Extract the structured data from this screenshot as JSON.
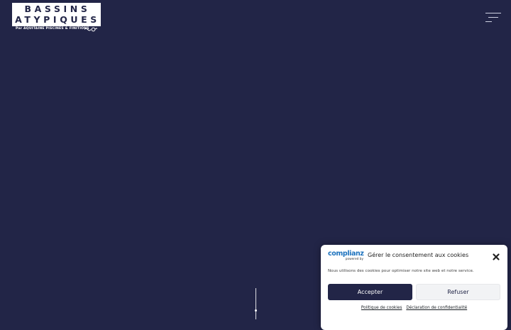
{
  "logo": {
    "line1": "BASSINS",
    "line2": "ATYPIQUES",
    "tagline": "Par AQUITAINE PISCINES & FINITIONS"
  },
  "menu": {
    "icon": "hamburger-menu-icon"
  },
  "scroll": {
    "icon": "scroll-down-indicator"
  },
  "cookies": {
    "brand": "complianz",
    "powered_by": "powered by",
    "title": "Gérer le consentement aux cookies",
    "close_icon": "close-icon",
    "message": "Nous utilisons des cookies pour optimiser notre site web et notre service.",
    "accept_label": "Accepter",
    "deny_label": "Refuser",
    "links": [
      "Politique de cookies",
      "Déclaration de confidentialité"
    ]
  },
  "colors": {
    "background": "#222547",
    "accent": "#222547",
    "brand_blue": "#1e73be",
    "panel": "#ffffff"
  }
}
